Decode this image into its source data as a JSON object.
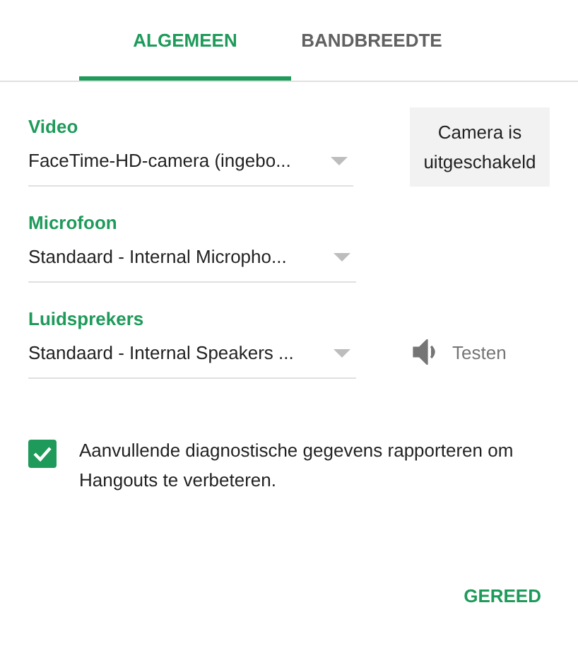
{
  "tabs": [
    {
      "label": "ALGEMEEN",
      "selected": true
    },
    {
      "label": "BANDBREEDTE",
      "selected": false
    }
  ],
  "devices": [
    {
      "label": "Video",
      "value": "FaceTime-HD-camera (ingebo...",
      "side": {
        "kind": "status",
        "text": "Camera is uitgeschakeld"
      }
    },
    {
      "label": "Microfoon",
      "value": "Standaard - Internal Micropho..."
    },
    {
      "label": "Luidsprekers",
      "value": "Standaard - Internal Speakers ...",
      "side": {
        "kind": "test",
        "text": "Testen"
      }
    }
  ],
  "diagnostics": {
    "checked": true,
    "text": "Aanvullende diagnostische gegevens rapporteren om Hangouts te verbeteren."
  },
  "done_button": "GEREED"
}
